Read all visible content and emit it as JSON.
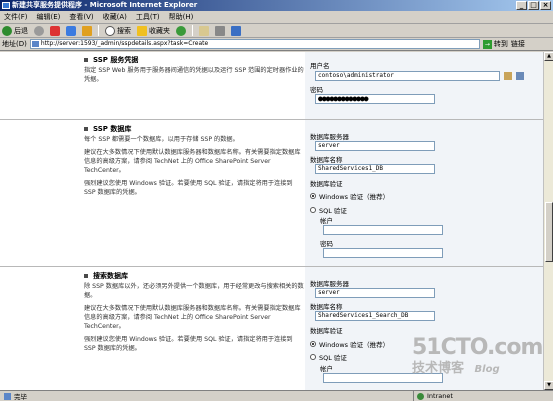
{
  "window": {
    "title": "新建共享服务提供程序 - Microsoft Internet Explorer"
  },
  "menu": [
    "文件(F)",
    "编辑(E)",
    "查看(V)",
    "收藏(A)",
    "工具(T)",
    "帮助(H)"
  ],
  "toolbar": {
    "back": "后退",
    "search": "搜索",
    "favorites": "收藏夹"
  },
  "address": {
    "label": "地址(D)",
    "url": "http://server:1593/_admin/sspdetails.aspx?task=Create",
    "go": "转到",
    "links": "链接"
  },
  "sections": {
    "account": {
      "title": "SSP 服务凭据",
      "desc": "指定 SSP Web 服务用于服务器间通信的凭据以及运行 SSP 范围的定时器作业的凭据。",
      "username_label": "用户名",
      "username_value": "contoso\\administrator",
      "password_label": "密码",
      "password_value": "●●●●●●●●●●●●●"
    },
    "ssp_db": {
      "title": "SSP 数据库",
      "p1": "每个 SSP 都需要一个数据库，以用于存储 SSP 的数据。",
      "p2": "建议在大多数情况下使用默认数据库服务器和数据库名称。有关需要指定数据库信息的高级方案，请参阅 TechNet 上的 Office SharePoint Server TechCenter。",
      "p3": "强烈建议您使用 Windows 验证。若要使用 SQL 验证，请指定将用于连接到 SSP 数据库的凭据。",
      "server_label": "数据库服务器",
      "server_value": "server",
      "dbname_label": "数据库名称",
      "dbname_value": "SharedServices1_DB",
      "auth_label": "数据库验证",
      "windows_auth": "Windows 验证（推荐）",
      "sql_auth": "SQL 验证",
      "account_label": "帐户",
      "password_label": "密码"
    },
    "search_db": {
      "title": "搜索数据库",
      "p1": "除 SSP 数据库以外，还必须另外提供一个数据库，用于经常更改与搜索相关的数据。",
      "p2": "建议在大多数情况下使用默认数据库服务器和数据库名称。有关需要指定数据库信息的高级方案，请参阅 TechNet 上的 Office SharePoint Server TechCenter。",
      "p3": "强烈建议您使用 Windows 验证。若要使用 SQL 验证，请指定将用于连接到 SSP 数据库的凭据。",
      "server_label": "数据库服务器",
      "server_value": "server",
      "dbname_label": "数据库名称",
      "dbname_value": "SharedServices1_Search_DB",
      "auth_label": "数据库验证",
      "windows_auth": "Windows 验证（推荐）",
      "sql_auth": "SQL 验证",
      "account_label": "帐户"
    }
  },
  "status": {
    "left": "完毕",
    "zone": "Intranet"
  },
  "watermark": {
    "logo": "51CTO.com",
    "sub": "技术博客",
    "blog": "Blog"
  }
}
